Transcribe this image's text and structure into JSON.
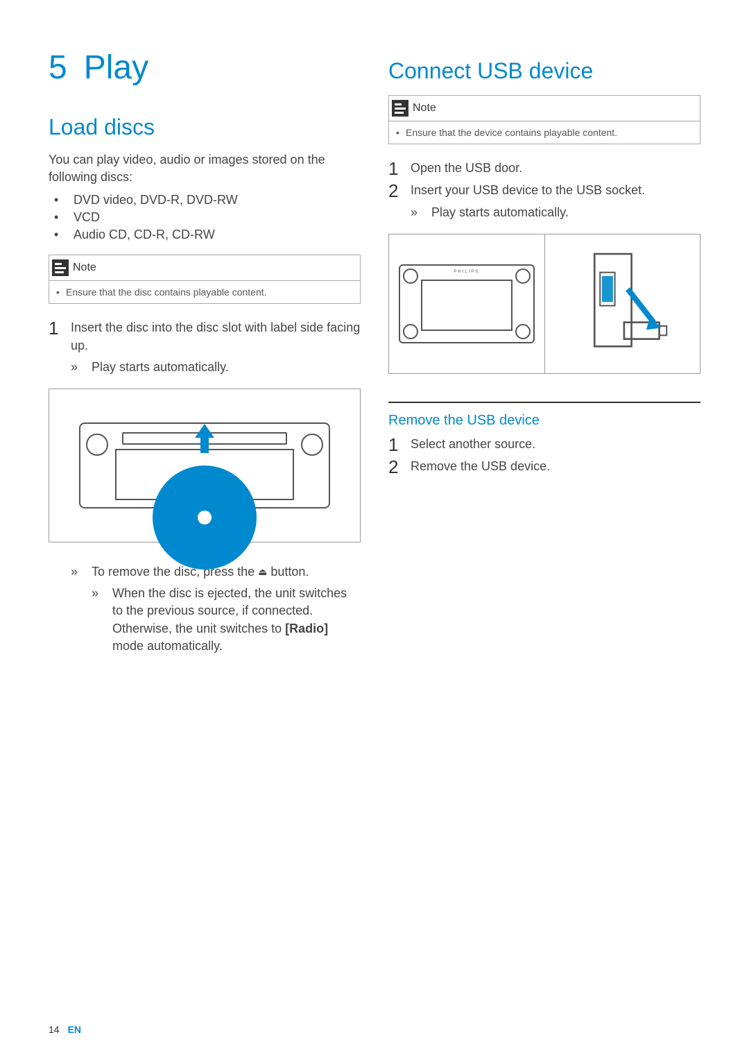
{
  "chapter": {
    "number": "5",
    "title": "Play"
  },
  "left": {
    "h2": "Load discs",
    "intro": "You can play video, audio or images stored on the following discs:",
    "bullets": [
      "DVD video, DVD-R, DVD-RW",
      "VCD",
      "Audio CD, CD-R, CD-RW"
    ],
    "note": {
      "label": "Note",
      "text": "Ensure that the disc contains playable content."
    },
    "step1": "Insert the disc into the disc slot with label side facing up.",
    "step1_sub": "Play starts automatically.",
    "remove_line_a": "To remove the disc, press the ",
    "remove_line_b": " button.",
    "remove_sub_a": "When the disc is ejected, the unit switches to the previous source, if connected. Otherwise, the unit switches to ",
    "remove_sub_bold": "[Radio]",
    "remove_sub_b": " mode automatically."
  },
  "right": {
    "h2": "Connect USB device",
    "note": {
      "label": "Note",
      "text": "Ensure that the device contains playable content."
    },
    "step1": "Open the USB door.",
    "step2": "Insert your USB device to the USB socket.",
    "step2_sub": "Play starts automatically.",
    "h3": "Remove the USB device",
    "rstep1": "Select another source.",
    "rstep2": "Remove the USB device.",
    "brand": "PHILIPS"
  },
  "footer": {
    "page": "14",
    "lang": "EN"
  }
}
